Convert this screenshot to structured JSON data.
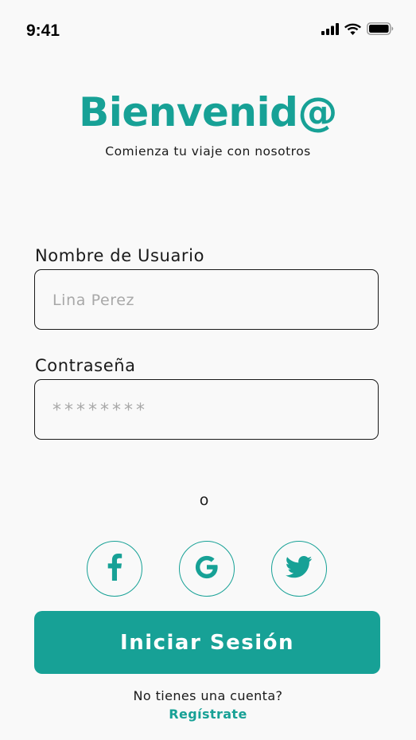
{
  "status_bar": {
    "time": "9:41",
    "icons": [
      "signal-icon",
      "wifi-icon",
      "battery-icon"
    ]
  },
  "header": {
    "title": "Bienvenid@",
    "subtitle": "Comienza tu viaje con nosotros"
  },
  "form": {
    "username": {
      "label": "Nombre de Usuario",
      "placeholder": "Lina Perez",
      "value": ""
    },
    "password": {
      "label": "Contraseña",
      "placeholder": "********",
      "value": ""
    }
  },
  "divider_text": "o",
  "social_buttons": [
    {
      "name": "facebook",
      "icon": "facebook-icon"
    },
    {
      "name": "google",
      "icon": "google-icon"
    },
    {
      "name": "twitter",
      "icon": "twitter-icon"
    }
  ],
  "login_button": "Iniciar Sesión",
  "footer": {
    "prompt": "No tienes una cuenta?",
    "register_link": "Regístrate"
  },
  "colors": {
    "accent": "#17a196",
    "background": "#f9f9f9",
    "text": "#1a1a1a",
    "placeholder": "#a8a8a8"
  }
}
